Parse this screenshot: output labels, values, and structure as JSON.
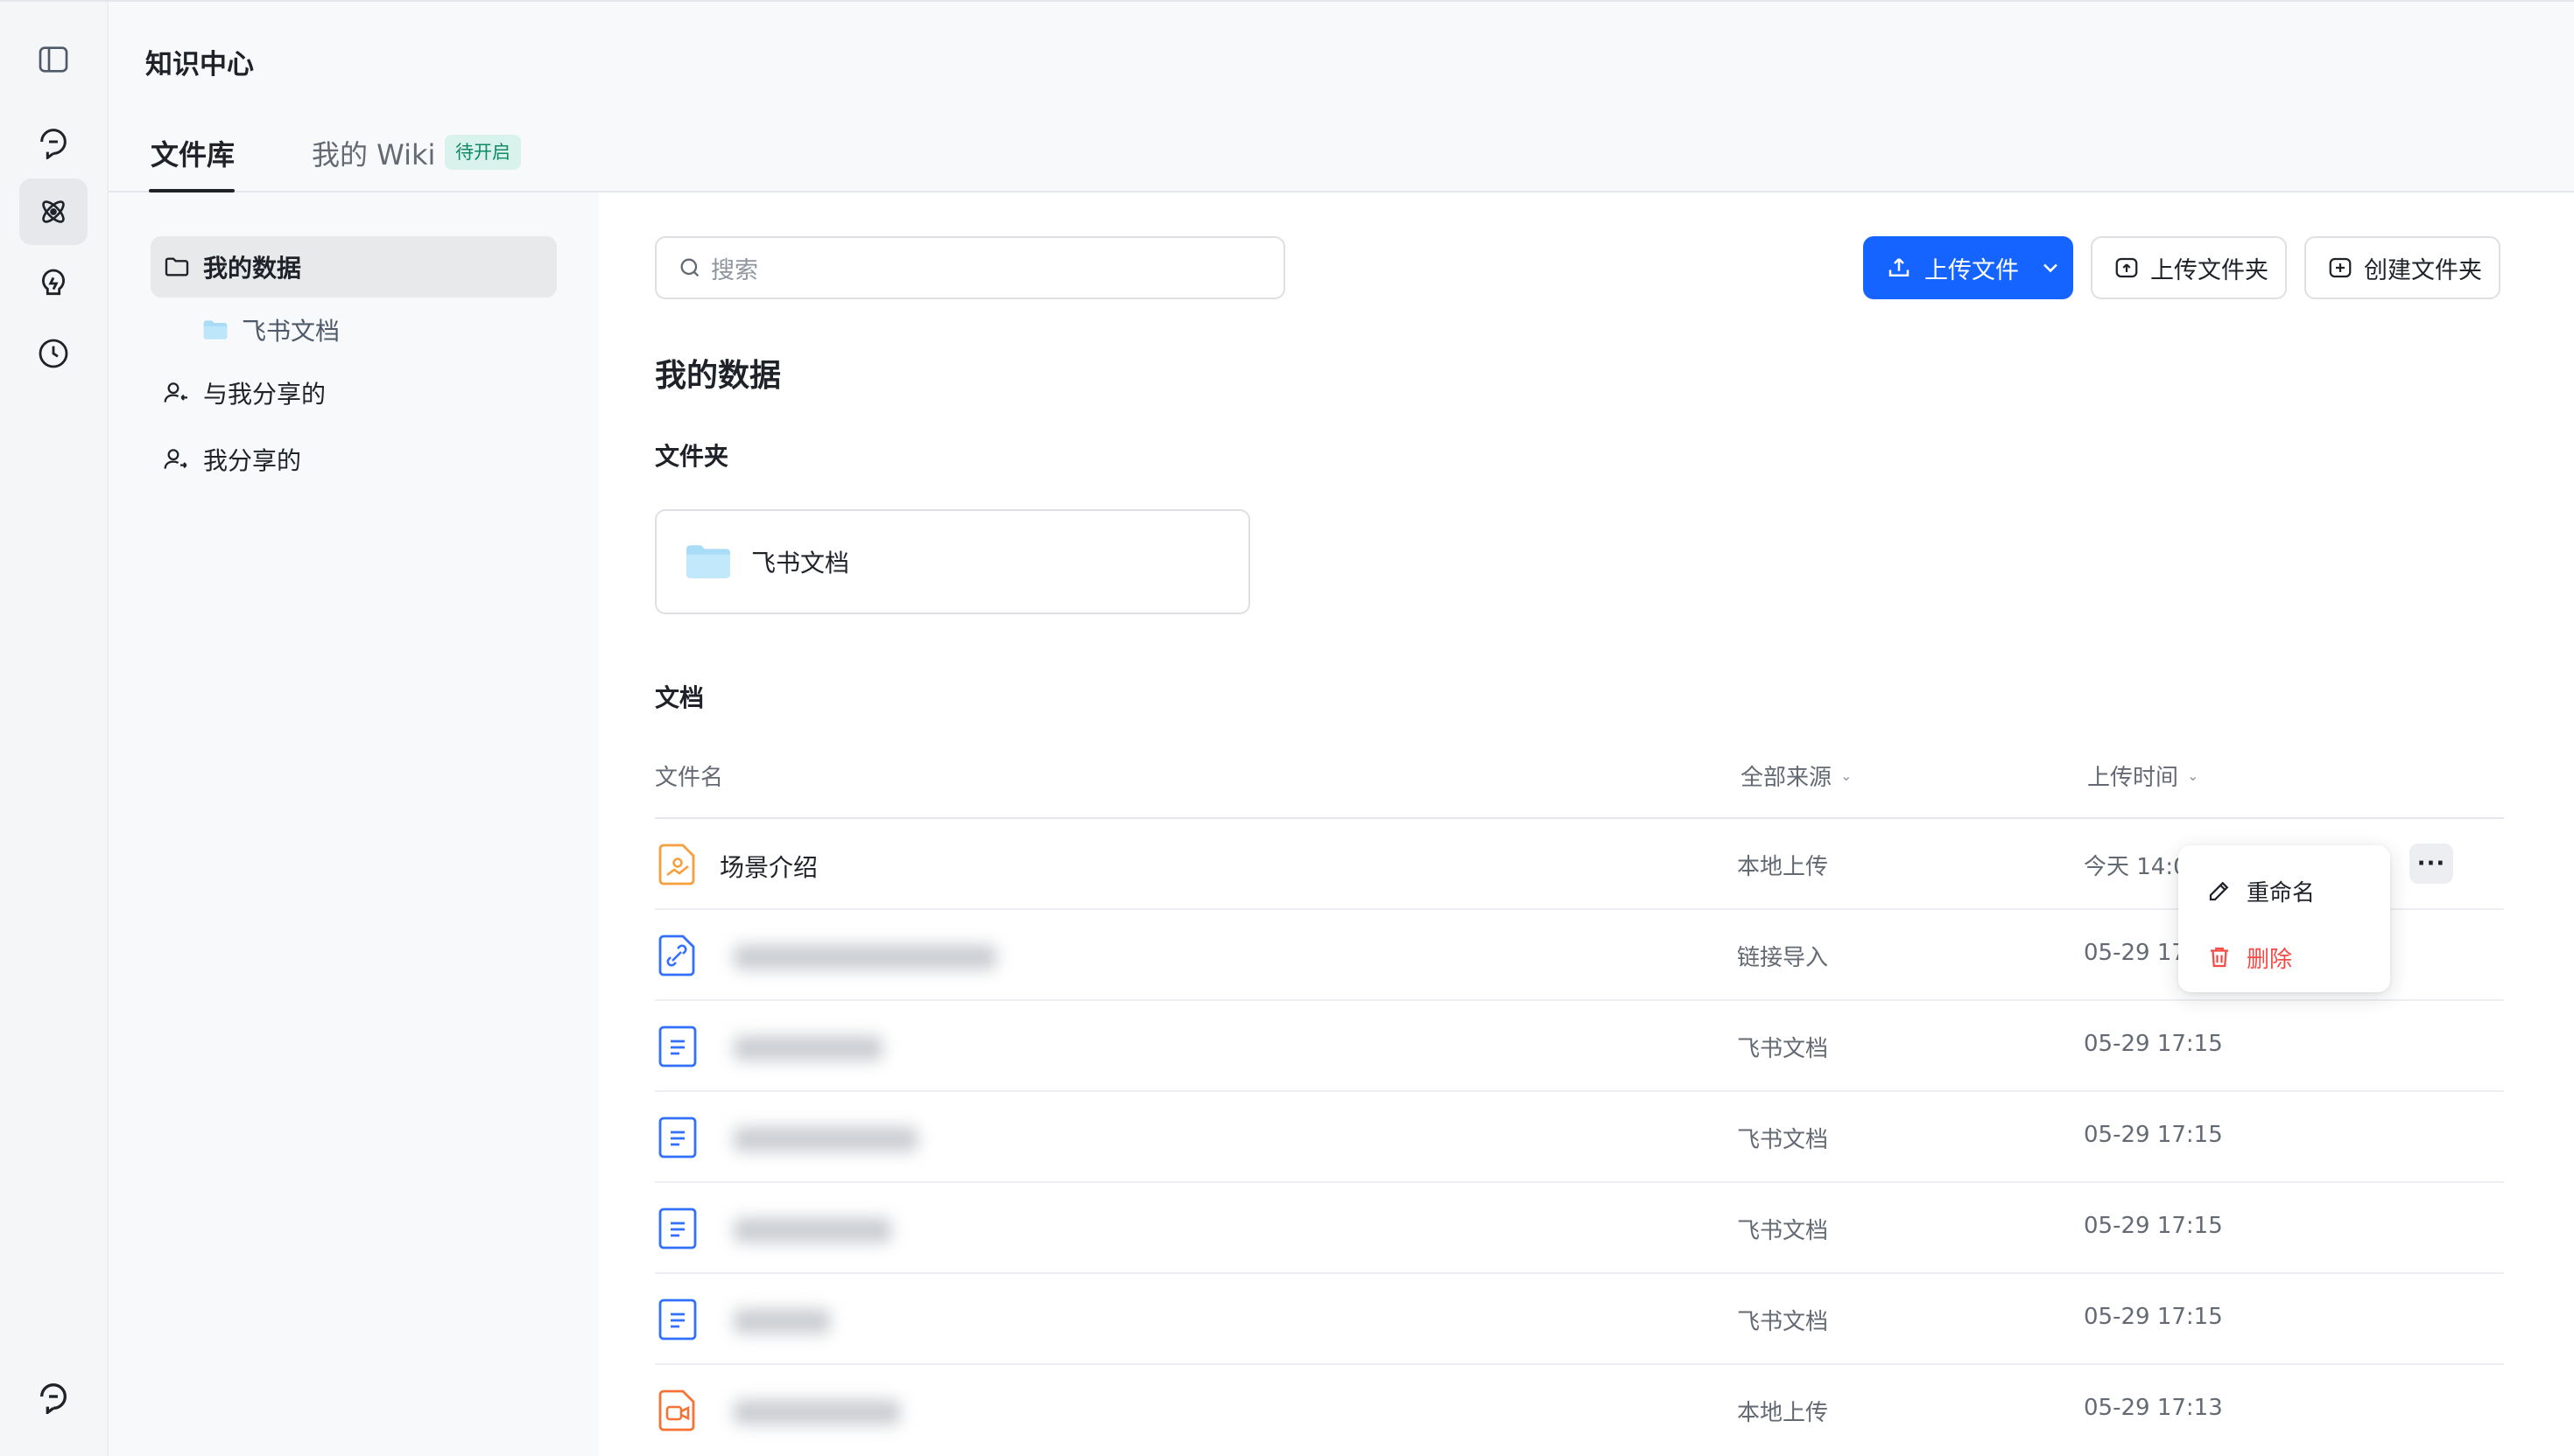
{
  "app": {
    "title": "知识中心"
  },
  "tabs": [
    {
      "label": "文件库",
      "active": true
    },
    {
      "label": "我的 Wiki",
      "badge": "待开启"
    }
  ],
  "rail": {
    "icons": [
      "sidebar-toggle-icon",
      "refresh-chat-icon",
      "atom-icon",
      "bulb-icon",
      "clock-icon",
      "bottom-chat-icon"
    ]
  },
  "tree": {
    "items": [
      {
        "label": "我的数据",
        "icon": "folder-outline-icon",
        "active": true
      },
      {
        "label": "飞书文档",
        "icon": "folder-filled-icon"
      },
      {
        "label": "与我分享的",
        "icon": "user-in-icon"
      },
      {
        "label": "我分享的",
        "icon": "user-out-icon"
      }
    ]
  },
  "search": {
    "placeholder": "搜索"
  },
  "toolbar": {
    "upload_file": "上传文件",
    "upload_folder": "上传文件夹",
    "create_folder": "创建文件夹"
  },
  "content": {
    "title": "我的数据",
    "folders_title": "文件夹",
    "folders": [
      {
        "name": "飞书文档"
      }
    ],
    "docs_title": "文档"
  },
  "table": {
    "columns": {
      "name": "文件名",
      "source": "全部来源",
      "time": "上传时间"
    },
    "rows": [
      {
        "name": "场景介绍",
        "icon": "image-file-icon",
        "source": "本地上传",
        "time": "今天 14:0"
      },
      {
        "name": "",
        "icon": "link-file-icon",
        "source": "链接导入",
        "time": "05-29 17"
      },
      {
        "name": "",
        "icon": "doc-file-icon",
        "source": "飞书文档",
        "time": "05-29 17:15"
      },
      {
        "name": "",
        "icon": "doc-file-icon",
        "source": "飞书文档",
        "time": "05-29 17:15"
      },
      {
        "name": "",
        "icon": "doc-file-icon",
        "source": "飞书文档",
        "time": "05-29 17:15"
      },
      {
        "name": "",
        "icon": "doc-file-icon",
        "source": "飞书文档",
        "time": "05-29 17:15"
      },
      {
        "name": "",
        "icon": "video-file-icon",
        "source": "本地上传",
        "time": "05-29 17:13"
      }
    ]
  },
  "context_menu": {
    "rename": "重命名",
    "delete": "删除"
  },
  "colors": {
    "primary": "#1664ff",
    "danger": "#f54a45",
    "badge_bg": "#d9f3ec",
    "badge_text": "#0f8a67"
  }
}
